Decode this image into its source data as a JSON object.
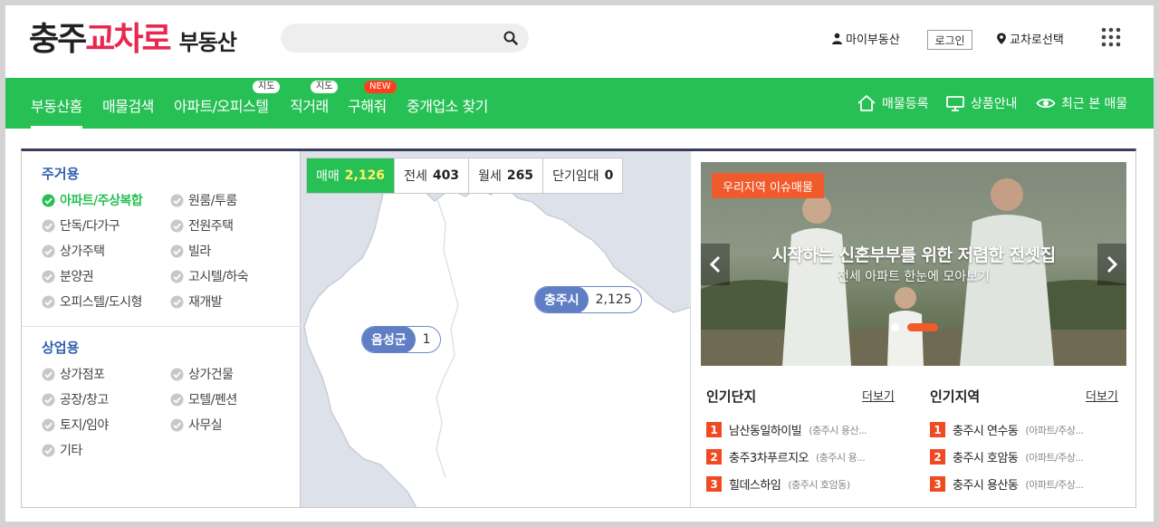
{
  "header": {
    "logo": {
      "part1": "충주",
      "part2": "교차로",
      "part3": "부동산"
    },
    "search": {
      "placeholder": ""
    },
    "links": {
      "my": "마이부동산",
      "login": "로그인",
      "region": "교차로선택"
    },
    "icons": [
      "user-icon",
      "pin-icon",
      "search-icon",
      "grid-icon"
    ]
  },
  "nav": {
    "items": [
      {
        "label": "부동산홈",
        "active": true
      },
      {
        "label": "매물검색"
      },
      {
        "label": "아파트/오피스텔",
        "badge": "지도"
      },
      {
        "label": "직거래",
        "badge": "지도"
      },
      {
        "label": "구해줘",
        "badge": "NEW"
      },
      {
        "label": "중개업소 찾기"
      }
    ],
    "right": [
      {
        "label": "매물등록",
        "icon": "home-icon"
      },
      {
        "label": "상품안내",
        "icon": "monitor-icon"
      },
      {
        "label": "최근 본 매물",
        "icon": "eye-icon"
      }
    ]
  },
  "categories": {
    "residential": {
      "title": "주거용",
      "items": [
        "아파트/주상복합",
        "원룸/투룸",
        "단독/다가구",
        "전원주택",
        "상가주택",
        "빌라",
        "분양권",
        "고시텔/하숙",
        "오피스텔/도시형",
        "재개발"
      ],
      "selected": "아파트/주상복합"
    },
    "commercial": {
      "title": "상업용",
      "items": [
        "상가점포",
        "상가건물",
        "공장/창고",
        "모텔/펜션",
        "토지/임야",
        "사무실",
        "기타"
      ]
    }
  },
  "map": {
    "tabs": [
      {
        "label": "매매",
        "count": "2,126",
        "active": true
      },
      {
        "label": "전세",
        "count": "403"
      },
      {
        "label": "월세",
        "count": "265"
      },
      {
        "label": "단기임대",
        "count": "0"
      }
    ],
    "pins": [
      {
        "name": "충주시",
        "count": "2,125"
      },
      {
        "name": "음성군",
        "count": "1"
      }
    ]
  },
  "banner": {
    "tag": "우리지역 이슈매물",
    "title": "시작하는 신혼부부를 위한 저렴한 전셋집",
    "subtitle": "전세 아파트 한눈에 모아보기"
  },
  "popular_complex": {
    "title": "인기단지",
    "more": "더보기",
    "items": [
      {
        "rank": "1",
        "name": "남산동일하이빌",
        "extra": "(충주시 용산..."
      },
      {
        "rank": "2",
        "name": "충주3차푸르지오",
        "extra": "(충주시 용..."
      },
      {
        "rank": "3",
        "name": "힐데스하임",
        "extra": "(충주시 호암동)"
      }
    ]
  },
  "popular_region": {
    "title": "인기지역",
    "more": "더보기",
    "items": [
      {
        "rank": "1",
        "name": "충주시 연수동",
        "extra": "(아파트/주상..."
      },
      {
        "rank": "2",
        "name": "충주시 호암동",
        "extra": "(아파트/주상..."
      },
      {
        "rank": "3",
        "name": "충주시 용산동",
        "extra": "(아파트/주상..."
      }
    ]
  },
  "colors": {
    "brand_green": "#27c055",
    "brand_red": "#e8284f",
    "rank_red": "#f04a23",
    "category_blue": "#2f5fae"
  }
}
